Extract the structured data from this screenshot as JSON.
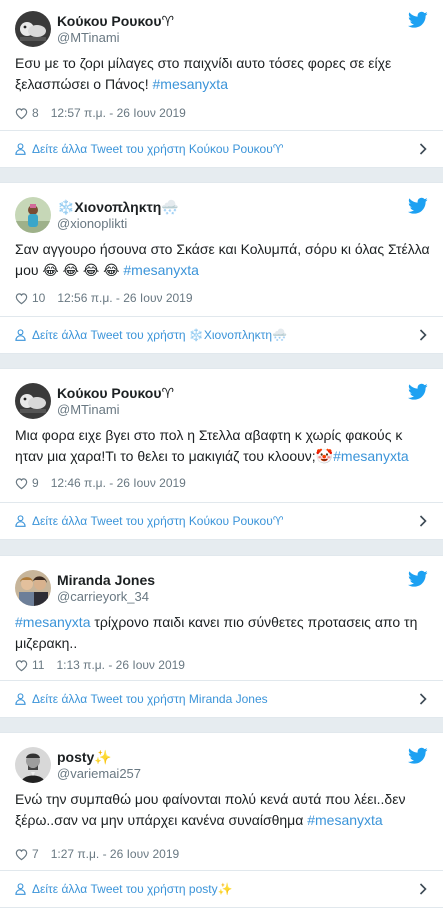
{
  "tweets": [
    {
      "name": "Κούκου Ρουκου♈",
      "handle": "@MTinami",
      "text_before": "Εσυ με το ζορι μίλαγες στο παιχνίδι αυτο τόσες φορες σε είχε ξελασπώσει ο Πάνος! ",
      "hashtag": "#mesanyxta",
      "text_after": "",
      "likes": "8",
      "time": "12:57 π.μ. - 26 Ιουν 2019",
      "more": "Δείτε άλλα Tweet του χρήστη Κούκου Ρουκου♈"
    },
    {
      "name": "❄️Χιονοπληκτη🌨️",
      "handle": "@xionoplikti",
      "text_before": "Σαν αγγουρο ήσουνα στο Σκάσε και Κολυμπά, σόρυ κι όλας Στέλλα μου 😂 😂 😂 😂 ",
      "hashtag": "#mesanyxta",
      "text_after": "",
      "likes": "10",
      "time": "12:56 π.μ. - 26 Ιουν 2019",
      "more": "Δείτε άλλα Tweet του χρήστη ❄️Χιονοπληκτη🌨️"
    },
    {
      "name": "Κούκου Ρουκου♈",
      "handle": "@MTinami",
      "text_before": "Μια φορα ειχε βγει στο πολ η Στελλα αβαφτη κ χωρίς φακούς κ ηταν μια χαρα!Τι το θελει το μακιγιάζ του κλοουν;🤡",
      "hashtag": "#mesanyxta",
      "text_after": "",
      "likes": "9",
      "time": "12:46 π.μ. - 26 Ιουν 2019",
      "more": "Δείτε άλλα Tweet του χρήστη Κούκου Ρουκου♈"
    },
    {
      "name": "Miranda Jones",
      "handle": "@carrieyork_34",
      "text_before": "",
      "hashtag": "#mesanyxta",
      "text_after": " τρίχρονο παιδι κανει πιο σύνθετες προτασεις απο τη μιζερακη..",
      "likes": "11",
      "time": "1:13 π.μ. - 26 Ιουν 2019",
      "more": "Δείτε άλλα Tweet του χρήστη Miranda Jones"
    },
    {
      "name": "posty✨",
      "handle": "@variemai257",
      "text_before": "Ενώ την συμπαθώ μου φαίνονται πολύ κενά αυτά που λέει..δεν ξέρω..σαν να μην υπάρχει κανένα συναίσθημα  ",
      "hashtag": "#mesanyxta",
      "text_after": "",
      "likes": "7",
      "time": "1:27 π.μ. - 26 Ιουν 2019",
      "more": "Δείτε άλλα Tweet του χρήστη posty✨"
    }
  ],
  "colors": {
    "link": "#3b94d9",
    "twitter_bird": "#1da1f2",
    "meta": "#697882",
    "background": "#e6ecf0"
  },
  "icons": [
    "twitter-bird-icon",
    "heart-icon",
    "user-icon",
    "chevron-right-icon"
  ]
}
